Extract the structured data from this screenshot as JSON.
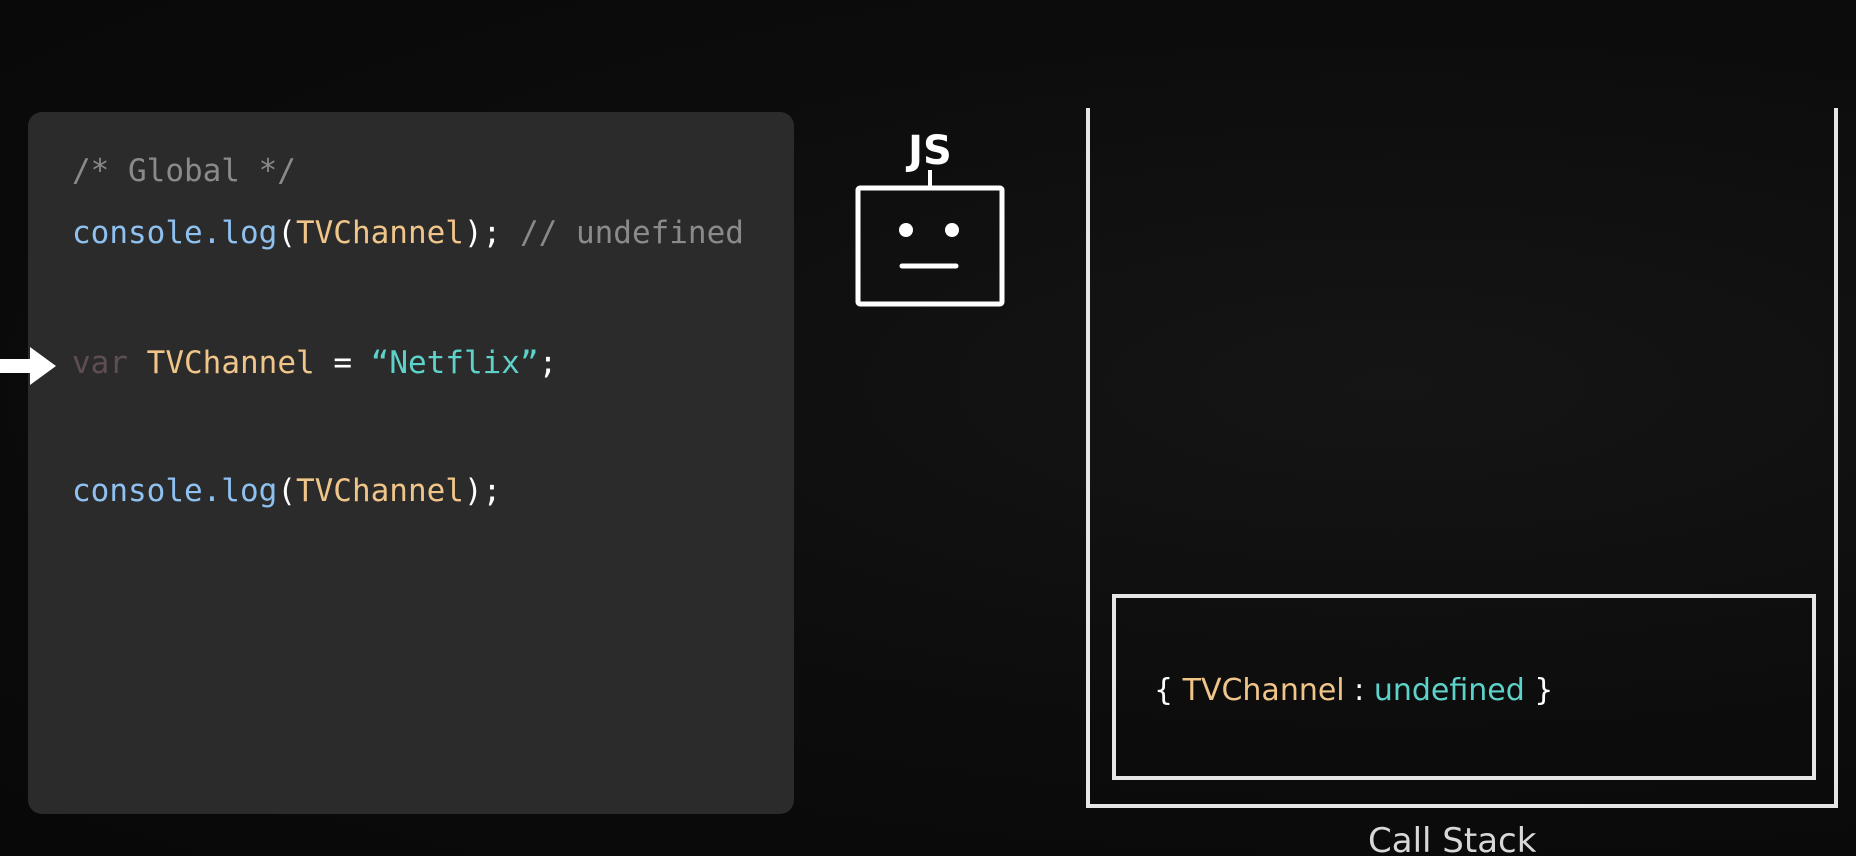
{
  "code": {
    "comment": "/* Global */",
    "line1": {
      "method": "console.log",
      "open": "(",
      "arg": "TVChannel",
      "close": ");",
      "comment": " // undefined"
    },
    "line2": {
      "keyword": "var",
      "name": "TVChannel",
      "eq": " = ",
      "string": "“Netflix”",
      "semi": ";"
    },
    "line3": {
      "method": "console.log",
      "open": "(",
      "arg": "TVChannel",
      "close": ");"
    }
  },
  "robot": {
    "label": "JS"
  },
  "call_stack": {
    "frame": {
      "open": "{ ",
      "key": "TVChannel",
      "sep": " : ",
      "value": "undefined",
      "close": " }"
    },
    "caption": "Call Stack"
  },
  "colors": {
    "panel": "#2b2b2b",
    "method": "#8fc1f0",
    "identifier": "#f0c589",
    "string": "#5dd2c9",
    "comment": "#8a8a8a"
  }
}
